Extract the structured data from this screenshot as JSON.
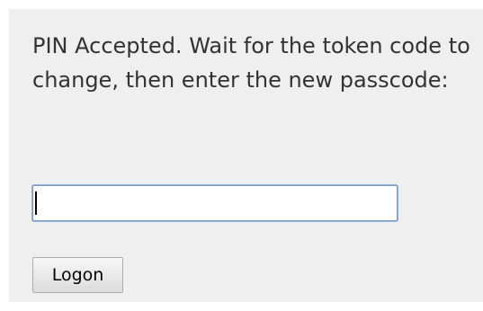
{
  "prompt": {
    "message": "PIN Accepted. Wait for the token code to change, then enter the new passcode:"
  },
  "passcode_field": {
    "value": "",
    "placeholder": ""
  },
  "logon_button": {
    "label": "Logon"
  }
}
